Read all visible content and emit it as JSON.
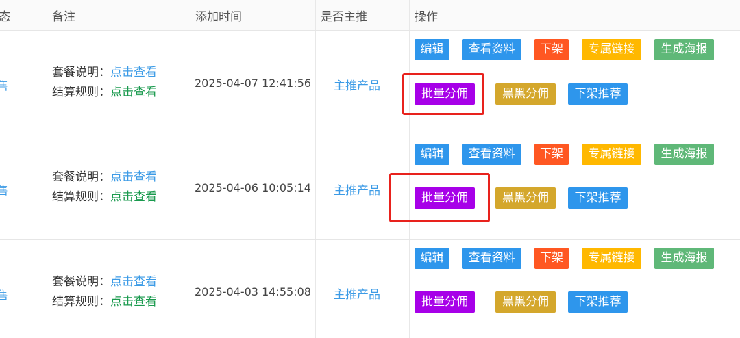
{
  "header": {
    "status_partial": "态",
    "remark": "备注",
    "add_time": "添加时间",
    "is_main": "是否主推",
    "actions": "操作"
  },
  "rows": [
    {
      "status_partial": "售",
      "package_label": "套餐说明：",
      "package_link": "点击查看",
      "settle_label": "结算规则：",
      "settle_link": "点击查看",
      "time": "2025-04-07 12:41:56",
      "main": "主推产品"
    },
    {
      "status_partial": "售",
      "package_label": "套餐说明：",
      "package_link": "点击查看",
      "settle_label": "结算规则：",
      "settle_link": "点击查看",
      "time": "2025-04-06 10:05:14",
      "main": "主推产品"
    },
    {
      "status_partial": "售",
      "package_label": "套餐说明：",
      "package_link": "点击查看",
      "settle_label": "结算规则：",
      "settle_link": "点击查看",
      "time": "2025-04-03 14:55:08",
      "main": "主推产品"
    }
  ],
  "buttons": {
    "edit": "编辑",
    "view_info": "查看资料",
    "off_shelf": "下架",
    "exclusive_link": "专属链接",
    "poster": "生成海报",
    "batch_commission": "批量分佣",
    "heihei_commission": "黑黑分佣",
    "off_recommend": "下架推荐"
  },
  "colors": {
    "blue": "#2e96ec",
    "red": "#ff5722",
    "yellow": "#ffb800",
    "green": "#5fb878",
    "purple": "#a700e8",
    "gold": "#d4a72c",
    "highlight": "#e8221d"
  }
}
